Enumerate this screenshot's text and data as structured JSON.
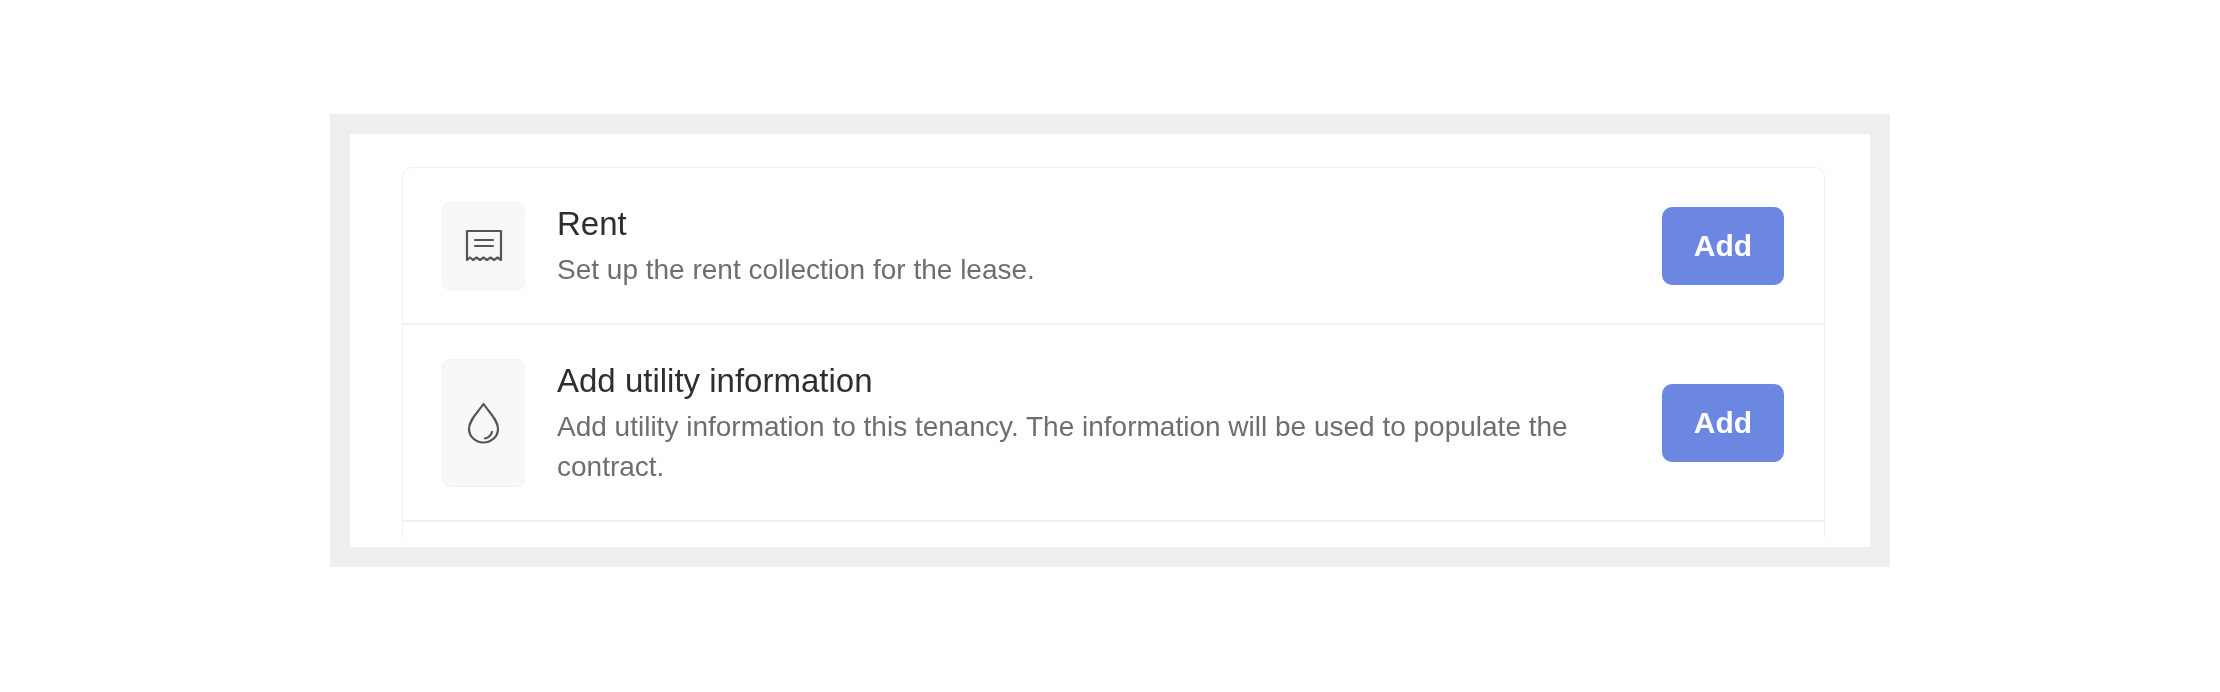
{
  "items": [
    {
      "kind": "rent",
      "title": "Rent",
      "description": "Set up the rent collection for the lease.",
      "button": "Add"
    },
    {
      "kind": "utility",
      "title": "Add utility information",
      "description": "Add utility information to this tenancy. The information will be used to populate the contract.",
      "button": "Add"
    }
  ]
}
